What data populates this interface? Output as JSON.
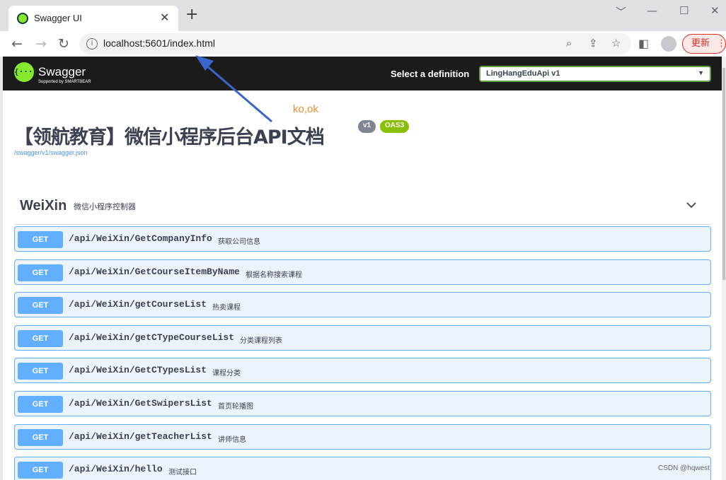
{
  "browser": {
    "tab_title": "Swagger UI",
    "tab_close": "✕",
    "new_tab": "+",
    "url": "localhost:5601/index.html",
    "update_label": "更新",
    "window_controls": [
      "﹀",
      "—",
      "☐",
      "✕"
    ]
  },
  "swagger": {
    "logo_text": "Swagger",
    "logo_sub": "Supported by SMARTBEAR",
    "logo_glyph": "{···}",
    "select_definition_label": "Select a definition",
    "definition_value": "LingHangEduApi v1"
  },
  "annotation": "ko,ok",
  "info": {
    "title": "【领航教育】微信小程序后台API文档",
    "version_badge": "v1",
    "oas_badge": "OAS3",
    "spec_link": "/swagger/v1/swagger.json"
  },
  "section": {
    "name": "WeiXin",
    "description": "微信小程序控制器"
  },
  "operations": [
    {
      "method": "GET",
      "path": "/api/WeiXin/GetCompanyInfo",
      "summary": "获取公司信息"
    },
    {
      "method": "GET",
      "path": "/api/WeiXin/GetCourseItemByName",
      "summary": "根据名称搜索课程"
    },
    {
      "method": "GET",
      "path": "/api/WeiXin/getCourseList",
      "summary": "热卖课程"
    },
    {
      "method": "GET",
      "path": "/api/WeiXin/getCTypeCourseList",
      "summary": "分类课程列表"
    },
    {
      "method": "GET",
      "path": "/api/WeiXin/GetCTypesList",
      "summary": "课程分类"
    },
    {
      "method": "GET",
      "path": "/api/WeiXin/GetSwipersList",
      "summary": "首页轮播图"
    },
    {
      "method": "GET",
      "path": "/api/WeiXin/getTeacherList",
      "summary": "讲师信息"
    },
    {
      "method": "GET",
      "path": "/api/WeiXin/hello",
      "summary": "测试接口"
    }
  ],
  "watermark": "CSDN @hqwest",
  "colors": {
    "topbar": "#1b1b1b",
    "get_method": "#61affe",
    "get_bg": "#ebf3fb",
    "oas_badge": "#89bf04",
    "version_badge": "#7d8492",
    "annotation": "#f08c2e",
    "arrow": "#3a66cc"
  }
}
